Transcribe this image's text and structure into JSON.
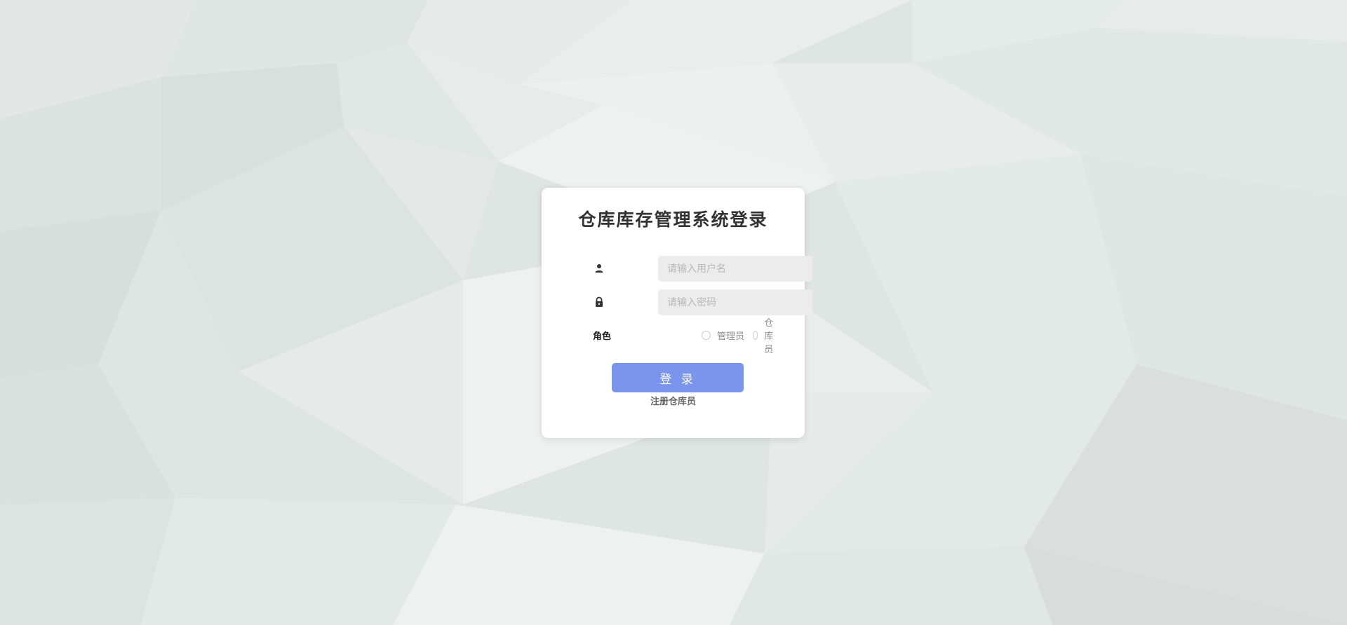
{
  "login": {
    "title": "仓库库存管理系统登录",
    "username": {
      "placeholder": "请输入用户名",
      "value": "",
      "icon": "user-icon"
    },
    "password": {
      "placeholder": "请输入密码",
      "value": "",
      "icon": "lock-icon"
    },
    "role": {
      "label": "角色",
      "options": [
        {
          "label": "管理员",
          "selected": false
        },
        {
          "label": "仓库员",
          "selected": false
        }
      ]
    },
    "submit_label": "登 录",
    "register_label": "注册仓库员"
  },
  "colors": {
    "button": "#7b95ec",
    "input_bg": "#ececec",
    "card_bg": "#ffffff"
  }
}
